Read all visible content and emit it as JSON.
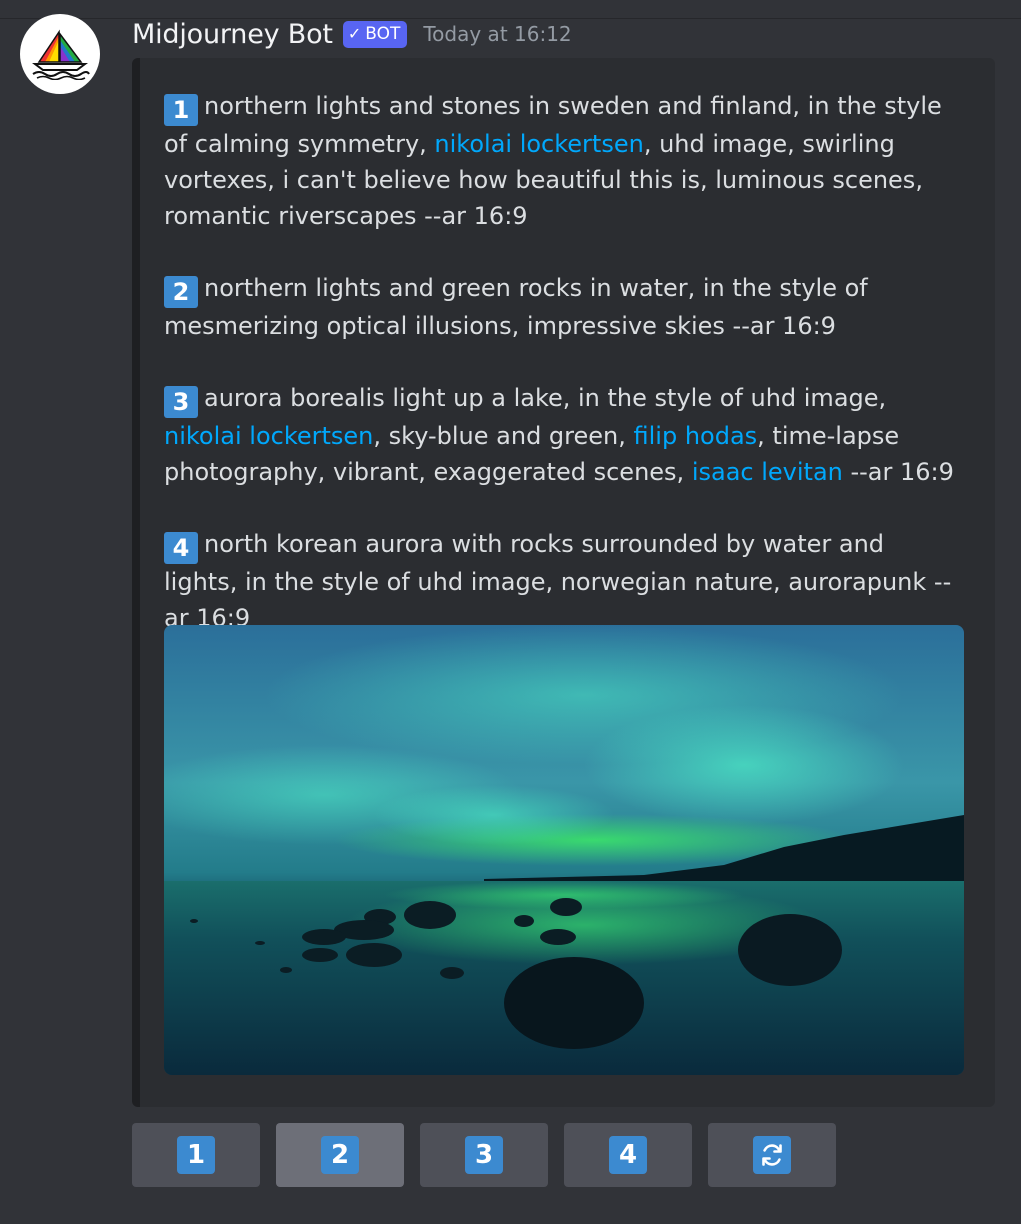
{
  "message": {
    "author": "Midjourney Bot",
    "bot_tag": "BOT",
    "timestamp": "Today at 16:12"
  },
  "prompts": [
    {
      "number": "1",
      "parts": [
        {
          "text": "northern lights and stones in sweden and finland, in the style of calming symmetry, ",
          "link": false
        },
        {
          "text": "nikolai lockertsen",
          "link": true
        },
        {
          "text": ", uhd image, swirling vortexes, i can't believe how beautiful this is, luminous scenes, romantic riverscapes --ar 16:9",
          "link": false
        }
      ]
    },
    {
      "number": "2",
      "parts": [
        {
          "text": "northern lights and green rocks in water, in the style of mesmerizing optical illusions, impressive skies --ar 16:9",
          "link": false
        }
      ]
    },
    {
      "number": "3",
      "parts": [
        {
          "text": "aurora borealis light up a lake, in the style of uhd image, ",
          "link": false
        },
        {
          "text": "nikolai lockertsen",
          "link": true
        },
        {
          "text": ", sky-blue and green, ",
          "link": false
        },
        {
          "text": "filip hodas",
          "link": true
        },
        {
          "text": ", time-lapse photography, vibrant, exaggerated scenes, ",
          "link": false
        },
        {
          "text": "isaac levitan",
          "link": true
        },
        {
          "text": " --ar 16:9",
          "link": false
        }
      ]
    },
    {
      "number": "4",
      "parts": [
        {
          "text": "north korean aurora with rocks surrounded by water and lights, in the style of uhd image, norwegian nature, aurorapunk --ar 16:9",
          "link": false
        }
      ]
    }
  ],
  "buttons": [
    {
      "label": "1",
      "icon": "keycap-1-icon",
      "active": false
    },
    {
      "label": "2",
      "icon": "keycap-2-icon",
      "active": true
    },
    {
      "label": "3",
      "icon": "keycap-3-icon",
      "active": false
    },
    {
      "label": "4",
      "icon": "keycap-4-icon",
      "active": false
    },
    {
      "label": "",
      "icon": "refresh-icon",
      "active": false
    }
  ],
  "colors": {
    "background": "#313338",
    "embed": "#2b2d31",
    "link": "#00a8fc",
    "bot_tag": "#5865f2",
    "keycap": "#3c8ad0"
  }
}
